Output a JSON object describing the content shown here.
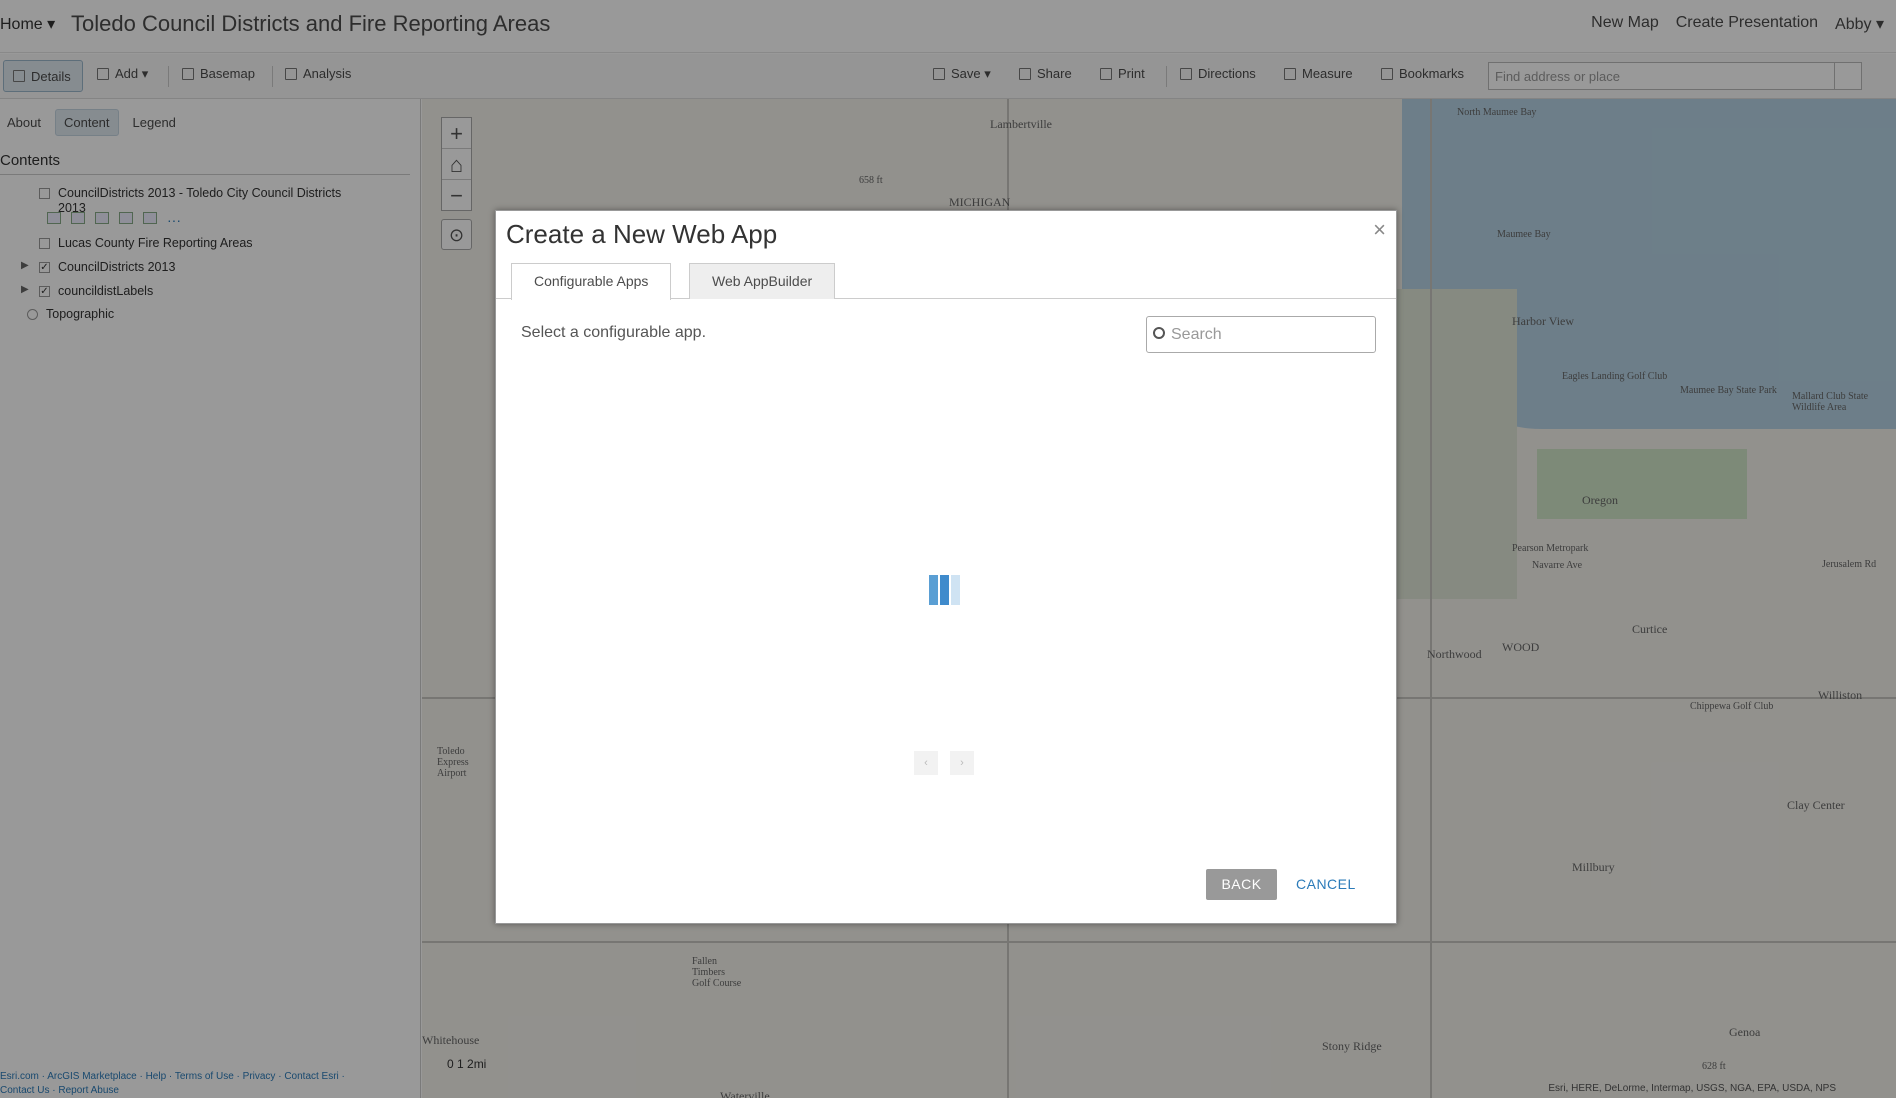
{
  "header": {
    "home": "Home ▾",
    "title": "Toledo Council Districts and Fire Reporting Areas",
    "new_map": "New Map",
    "create_presentation": "Create Presentation",
    "user": "Abby ▾"
  },
  "toolbar": {
    "details": "Details",
    "add": "Add ▾",
    "basemap": "Basemap",
    "analysis": "Analysis",
    "save": "Save ▾",
    "share": "Share",
    "print": "Print",
    "directions": "Directions",
    "measure": "Measure",
    "bookmarks": "Bookmarks",
    "search_placeholder": "Find address or place"
  },
  "sidebar": {
    "tab_about": "About",
    "tab_content": "Content",
    "tab_legend": "Legend",
    "contents_heading": "Contents",
    "layers": [
      {
        "label": "CouncilDistricts 2013 - Toledo City Council Districts 2013",
        "checked": false
      },
      {
        "label": "Lucas County Fire Reporting Areas",
        "checked": false
      },
      {
        "label": "CouncilDistricts 2013",
        "checked": true
      },
      {
        "label": "councildistLabels",
        "checked": true
      },
      {
        "label": "Topographic",
        "checked": false
      }
    ],
    "footer_line1": "Esri.com · ArcGIS Marketplace · Help · Terms of Use · Privacy · Contact Esri ·",
    "footer_line2": "Contact Us · Report Abuse"
  },
  "map": {
    "labels": [
      "Lambertville",
      "MICHIGAN",
      "658 ft",
      "North Maumee Bay",
      "Maumee Bay",
      "Harbor View",
      "Eagles Landing Golf Club",
      "Maumee Bay State Park",
      "Mallard Club State Wildlife Area",
      "Oregon",
      "Pearson Metropark",
      "Navarre Ave",
      "Jerusalem Rd",
      "Curtice",
      "Northwood",
      "WOOD",
      "Williston",
      "Chippewa Golf Club",
      "Clay Center",
      "Millbury",
      "Toledo Express Airport",
      "Fallen Timbers Golf Course",
      "Whitehouse",
      "Stony Ridge",
      "Genoa",
      "628 ft",
      "Waterville"
    ],
    "scale": "0      1      2mi",
    "attribution": "Esri, HERE, DeLorme, Intermap, USGS, NGA, EPA, USDA, NPS"
  },
  "modal": {
    "title": "Create a New Web App",
    "close": "×",
    "tab1": "Configurable Apps",
    "tab2": "Web AppBuilder",
    "prompt": "Select a configurable app.",
    "search_placeholder": "Search",
    "prev": "‹",
    "next": "›",
    "back": "BACK",
    "cancel": "CANCEL"
  },
  "colors": {
    "accent": "#2b7bb9",
    "spinner": "#5a9fd4"
  }
}
